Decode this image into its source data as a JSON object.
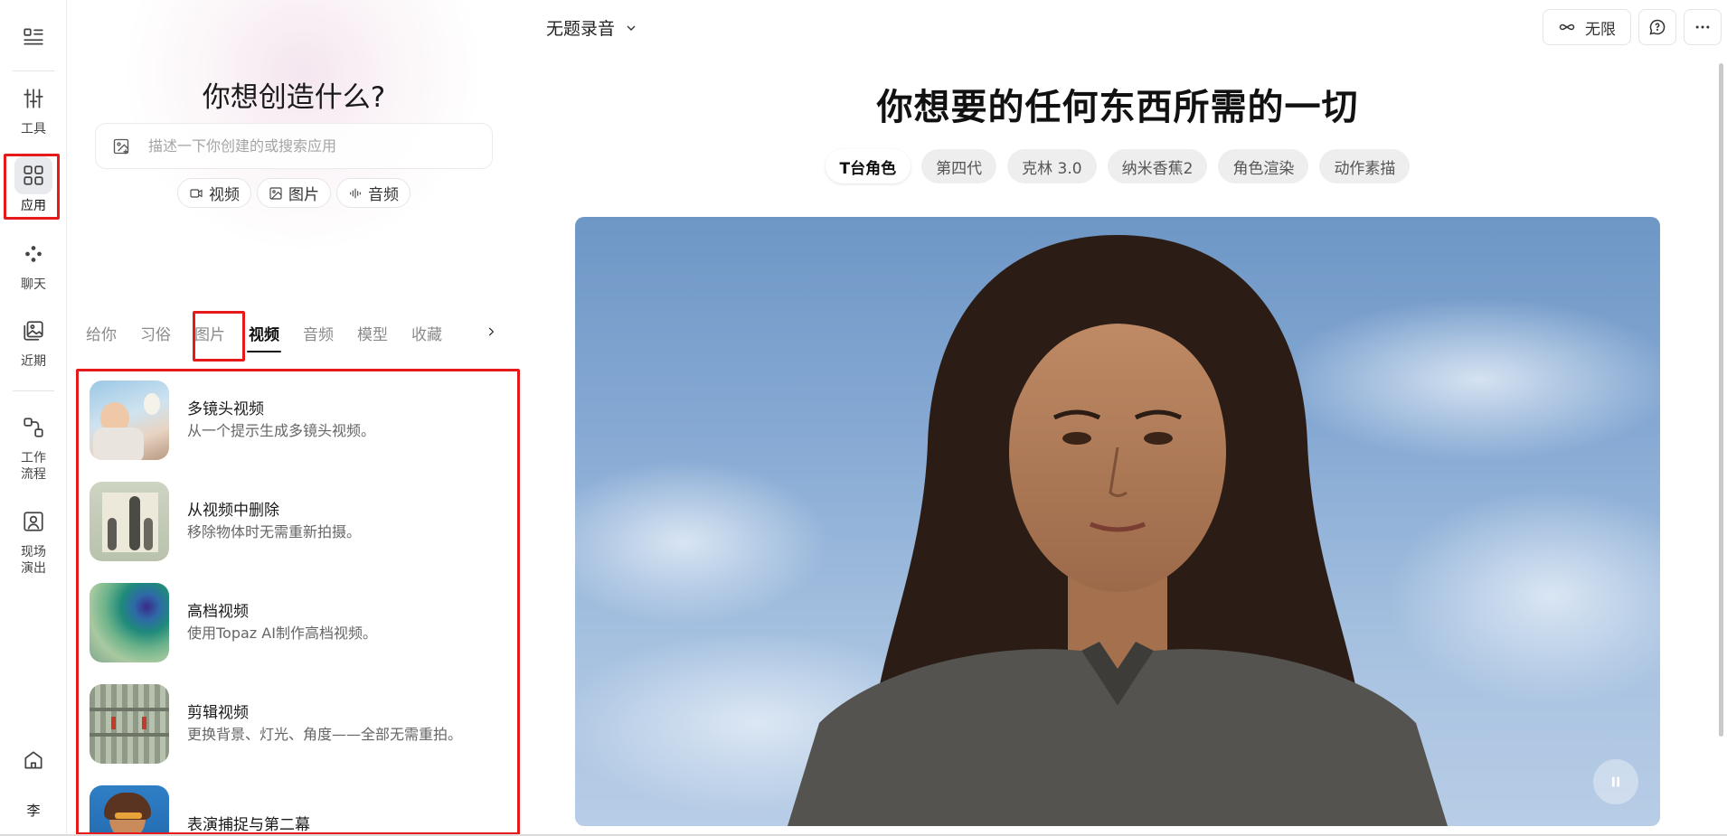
{
  "rail": {
    "items": [
      {
        "id": "menu",
        "icon": "menu-list-icon",
        "label": ""
      },
      {
        "id": "tools",
        "icon": "sliders-icon",
        "label": "工具"
      },
      {
        "id": "apps",
        "icon": "grid-icon",
        "label": "应用",
        "active": true
      },
      {
        "id": "chat",
        "icon": "chat-nodes-icon",
        "label": "聊天"
      },
      {
        "id": "recent",
        "icon": "image-stack-icon",
        "label": "近期"
      },
      {
        "id": "workflow",
        "icon": "workflow-icon",
        "label": "工作",
        "label2": "流程"
      },
      {
        "id": "live",
        "icon": "portrait-icon",
        "label": "现场",
        "label2": "演出"
      },
      {
        "id": "home",
        "icon": "home-icon",
        "label": ""
      },
      {
        "id": "avatar",
        "icon": "",
        "label": "李"
      }
    ]
  },
  "panel": {
    "title": "你想创造什么?",
    "search_placeholder": "描述一下你创建的或搜索应用",
    "chips": [
      {
        "icon": "video-icon",
        "label": "视频"
      },
      {
        "icon": "image-icon",
        "label": "图片"
      },
      {
        "icon": "audio-wave-icon",
        "label": "音频"
      }
    ],
    "tabs": [
      "给你",
      "习俗",
      "图片",
      "视频",
      "音频",
      "模型",
      "收藏"
    ],
    "active_tab": "视频",
    "items": [
      {
        "title": "多镜头视频",
        "desc": "从一个提示生成多镜头视频。"
      },
      {
        "title": "从视频中删除",
        "desc": "移除物体时无需重新拍摄。"
      },
      {
        "title": "高档视频",
        "desc": "使用Topaz AI制作高档视频。"
      },
      {
        "title": "剪辑视频",
        "desc": "更换背景、灯光、角度——全部无需重拍。"
      },
      {
        "title": "表演捕捉与第二幕",
        "desc": ""
      }
    ]
  },
  "main": {
    "doc_title": "无题录音",
    "unlimited_label": "无限",
    "hero_title": "你想要的任何东西所需的一切",
    "pills": [
      "T台角色",
      "第四代",
      "克林 3.0",
      "纳米香蕉2",
      "角色渲染",
      "动作素描"
    ],
    "active_pill": "T台角色"
  },
  "colors": {
    "highlight": "#e51b1b",
    "sky": "#86a9d3"
  }
}
